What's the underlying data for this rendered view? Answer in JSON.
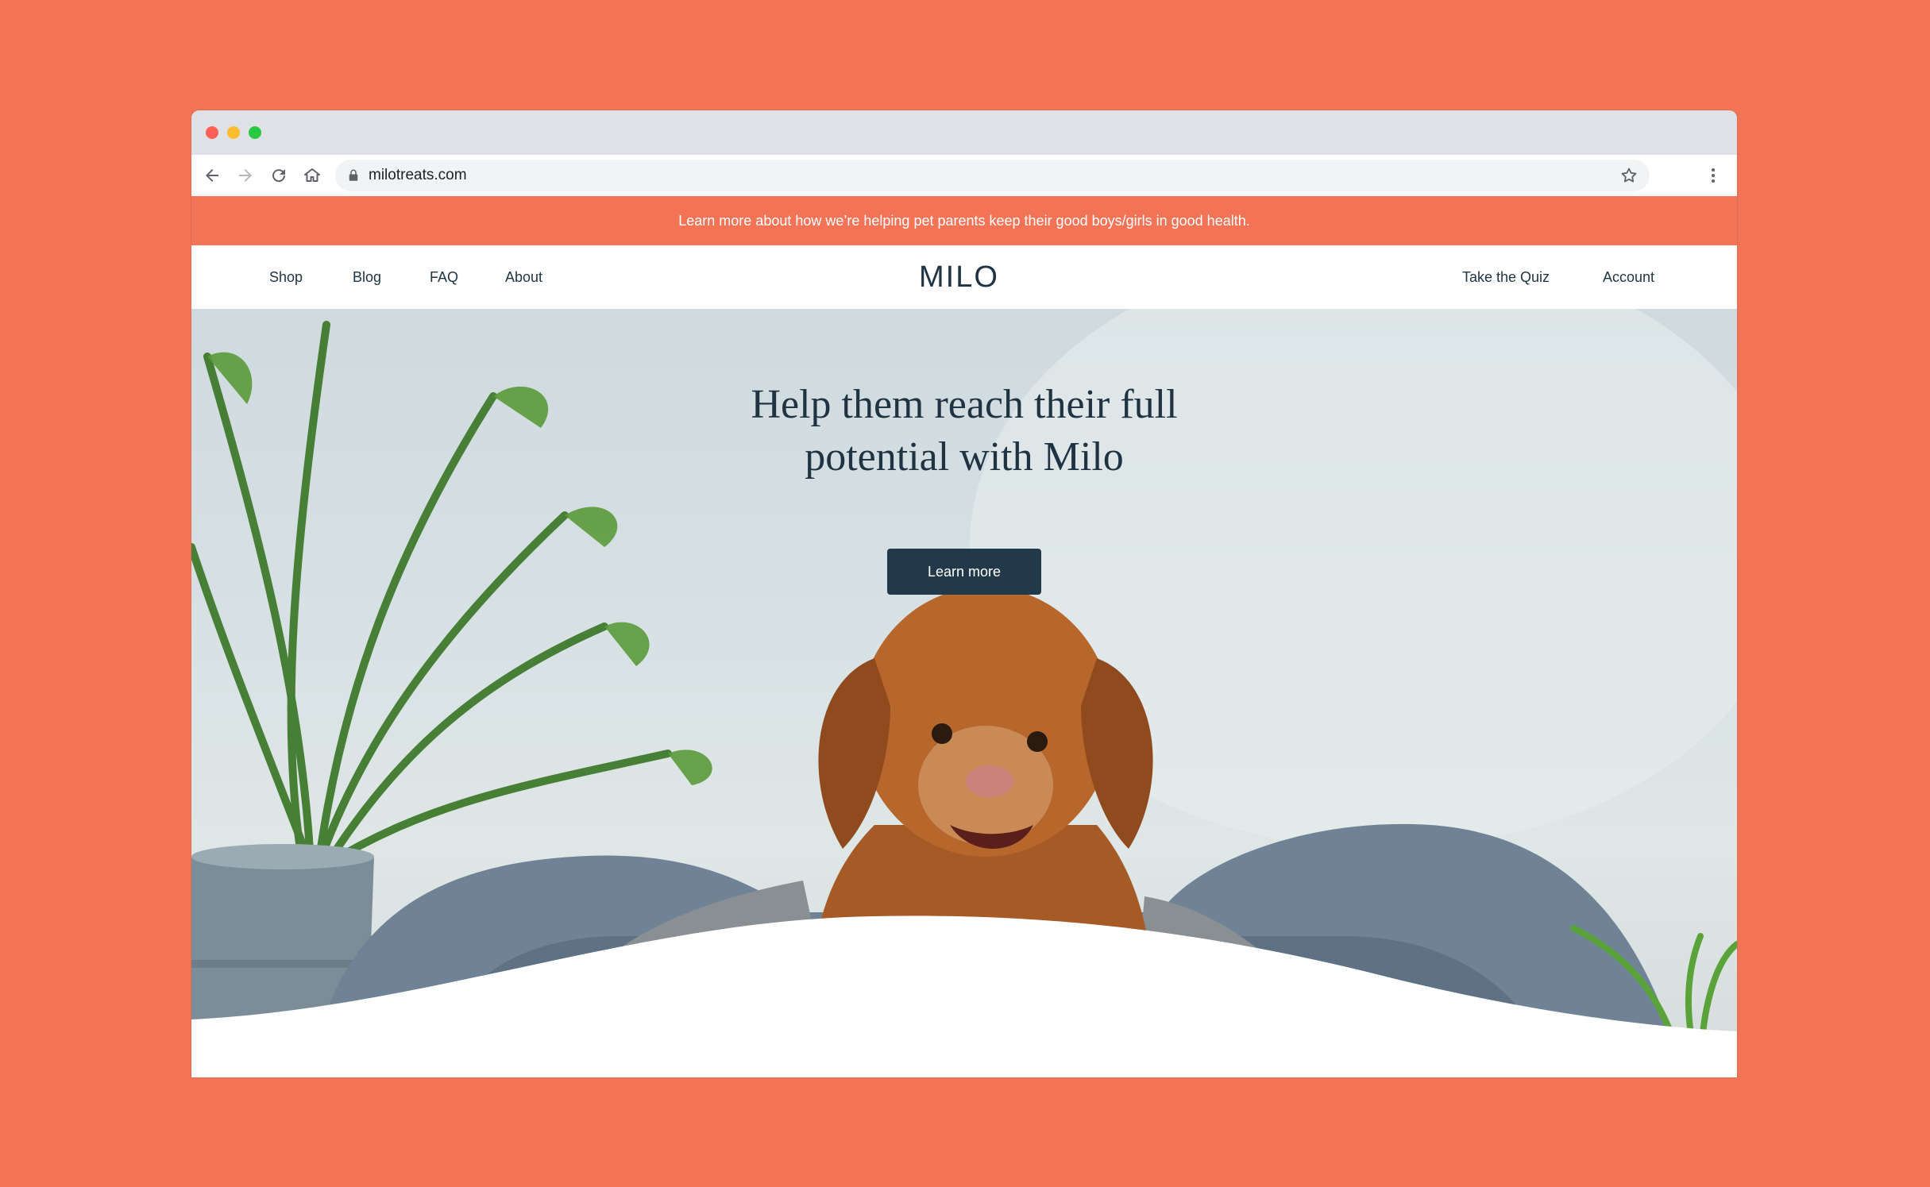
{
  "browser": {
    "url": "milotreats.com"
  },
  "announcement": {
    "text": "Learn more about how we’re helping pet parents keep their good boys/girls in good health."
  },
  "nav": {
    "left": [
      "Shop",
      "Blog",
      "FAQ",
      "About"
    ],
    "logo": "MILO",
    "right": [
      "Take the Quiz",
      "Account"
    ]
  },
  "hero": {
    "title_line1": "Help them reach their full",
    "title_line2": "potential with Milo",
    "cta_label": "Learn more"
  },
  "colors": {
    "background": "#F27356",
    "announcement_bg": "#F27356",
    "navy": "#1F3343",
    "button": "#22394A"
  }
}
